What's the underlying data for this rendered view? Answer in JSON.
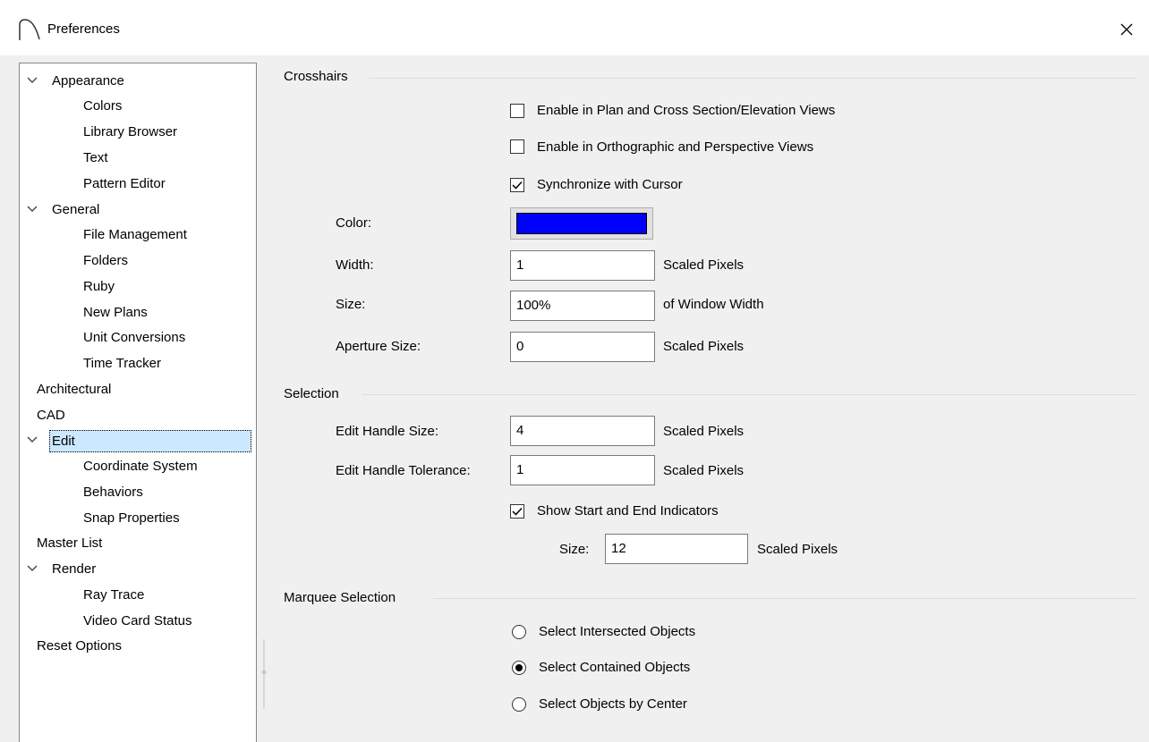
{
  "window": {
    "title": "Preferences",
    "close_icon": "close-icon",
    "app_icon": "arch-icon"
  },
  "tree": {
    "items": [
      {
        "label": "Appearance",
        "expanded": true
      },
      {
        "label": "Colors"
      },
      {
        "label": "Library Browser"
      },
      {
        "label": "Text"
      },
      {
        "label": "Pattern Editor"
      },
      {
        "label": "General",
        "expanded": true
      },
      {
        "label": "File Management"
      },
      {
        "label": "Folders"
      },
      {
        "label": "Ruby"
      },
      {
        "label": "New Plans"
      },
      {
        "label": "Unit Conversions"
      },
      {
        "label": "Time Tracker"
      },
      {
        "label": "Architectural"
      },
      {
        "label": "CAD"
      },
      {
        "label": "Edit",
        "expanded": true,
        "selected": true
      },
      {
        "label": "Coordinate System"
      },
      {
        "label": "Behaviors"
      },
      {
        "label": "Snap Properties"
      },
      {
        "label": "Master List"
      },
      {
        "label": "Render",
        "expanded": true
      },
      {
        "label": "Ray Trace"
      },
      {
        "label": "Video Card Status"
      },
      {
        "label": "Reset Options"
      }
    ]
  },
  "crosshairs": {
    "title": "Crosshairs",
    "enable_plan": {
      "label": "Enable in Plan and Cross Section/Elevation Views",
      "checked": false
    },
    "enable_ortho": {
      "label": "Enable in Orthographic and Perspective Views",
      "checked": false
    },
    "sync_cursor": {
      "label": "Synchronize with Cursor",
      "checked": true
    },
    "color_label": "Color:",
    "color_value": "#0000ff",
    "width_label": "Width:",
    "width_value": "1",
    "width_unit": "Scaled Pixels",
    "size_label": "Size:",
    "size_value": "100%",
    "size_unit": "of Window Width",
    "aperture_label": "Aperture Size:",
    "aperture_value": "0",
    "aperture_unit": "Scaled Pixels"
  },
  "selection": {
    "title": "Selection",
    "handle_size_label": "Edit Handle Size:",
    "handle_size_value": "4",
    "handle_size_unit": "Scaled Pixels",
    "handle_tol_label": "Edit Handle Tolerance:",
    "handle_tol_value": "1",
    "handle_tol_unit": "Scaled Pixels",
    "show_indicators": {
      "label": "Show Start and End Indicators",
      "checked": true
    },
    "ind_size_label": "Size:",
    "ind_size_value": "12",
    "ind_size_unit": "Scaled Pixels"
  },
  "marquee": {
    "title": "Marquee Selection",
    "options": [
      {
        "label": "Select Intersected Objects",
        "selected": false
      },
      {
        "label": "Select Contained Objects",
        "selected": true
      },
      {
        "label": "Select Objects by Center",
        "selected": false
      }
    ]
  }
}
